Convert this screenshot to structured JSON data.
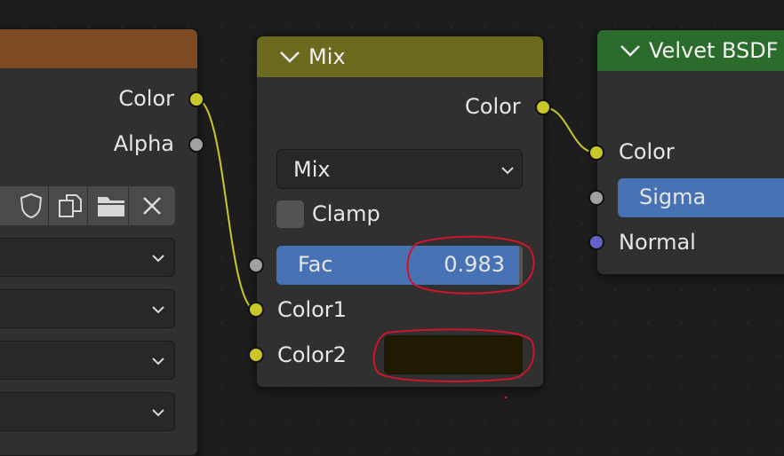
{
  "left_node": {
    "outputs": [
      "Color",
      "Alpha"
    ]
  },
  "mix_node": {
    "title": "Mix",
    "output_label": "Color",
    "blend_mode": "Mix",
    "clamp_label": "Clamp",
    "fac_label": "Fac",
    "fac_value": "0.983",
    "color1_label": "Color1",
    "color2_label": "Color2",
    "color2_swatch": "#1f1a00"
  },
  "velvet_node": {
    "title": "Velvet BSDF",
    "inputs": [
      "Color",
      "Sigma",
      "Normal"
    ]
  },
  "colors": {
    "left_header": "#7d4a22",
    "mix_header": "#6b6a1f",
    "velvet_header": "#2b6b2b",
    "accent_blue": "#4772b3",
    "annotation_red": "#d0142a"
  }
}
